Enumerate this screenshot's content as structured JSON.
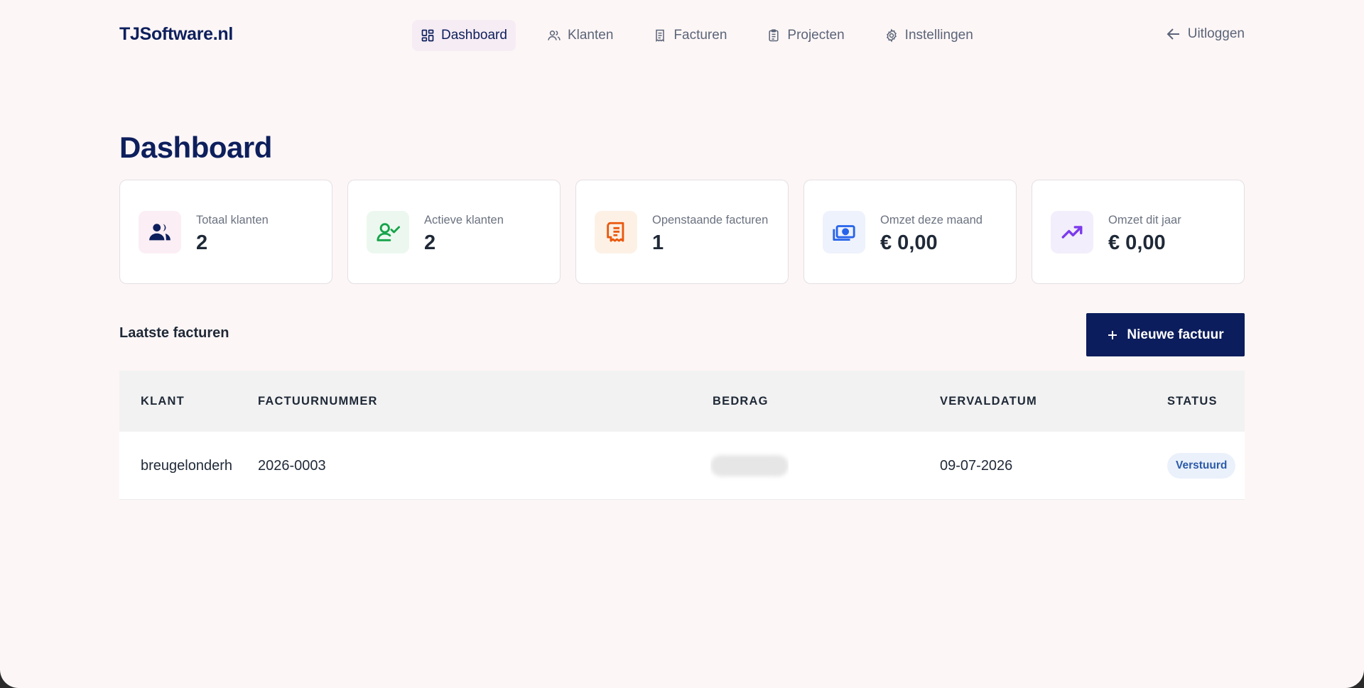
{
  "brand": "TJSoftware.nl",
  "nav": {
    "items": [
      {
        "label": "Dashboard",
        "icon": "dashboard-icon",
        "active": true
      },
      {
        "label": "Klanten",
        "icon": "users-icon",
        "active": false
      },
      {
        "label": "Facturen",
        "icon": "receipt-icon",
        "active": false
      },
      {
        "label": "Projecten",
        "icon": "clipboard-icon",
        "active": false
      },
      {
        "label": "Instellingen",
        "icon": "gear-icon",
        "active": false
      }
    ],
    "logout_label": "Uitloggen"
  },
  "page_title": "Dashboard",
  "stats": [
    {
      "label": "Totaal klanten",
      "value": "2",
      "icon": "users-icon",
      "color": "#0d1f5c",
      "bg": "#fbeef4"
    },
    {
      "label": "Actieve klanten",
      "value": "2",
      "icon": "user-check-icon",
      "color": "#16a34a",
      "bg": "#ecf8ef"
    },
    {
      "label": "Openstaande facturen",
      "value": "1",
      "icon": "receipt-icon",
      "color": "#ea580c",
      "bg": "#fdf1e6"
    },
    {
      "label": "Omzet deze maand",
      "value": "€ 0,00",
      "icon": "cash-icon",
      "color": "#2563eb",
      "bg": "#eef2fc"
    },
    {
      "label": "Omzet dit jaar",
      "value": "€ 0,00",
      "icon": "trend-up-icon",
      "color": "#7c3aed",
      "bg": "#f3eefb"
    }
  ],
  "invoices": {
    "title": "Laatste facturen",
    "new_button": "Nieuwe factuur",
    "columns": [
      "KLANT",
      "FACTUURNUMMER",
      "BEDRAG",
      "VERVALDATUM",
      "STATUS"
    ],
    "rows": [
      {
        "client": "breugelonderh",
        "number": "2026-0003",
        "amount": "",
        "due": "09-07-2026",
        "status": "Verstuurd"
      }
    ]
  },
  "colors": {
    "primary": "#0b1d5c",
    "background": "#fdf6f6",
    "status_sent_bg": "#eaf1fb",
    "status_sent_text": "#2d5aa8"
  }
}
